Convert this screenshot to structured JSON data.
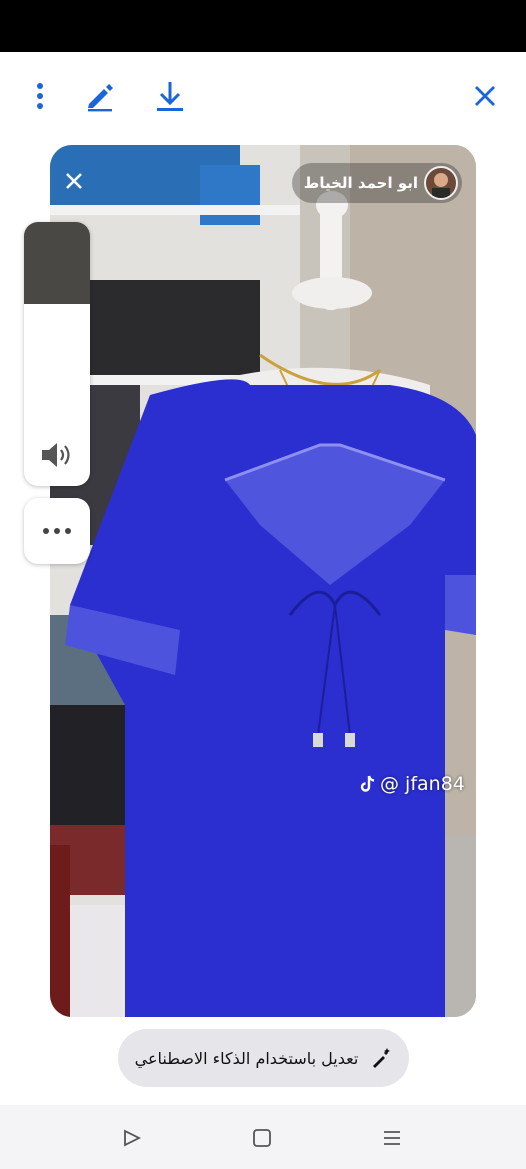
{
  "toolbar": {
    "icons": [
      "more-vertical-icon",
      "edit-pen-icon",
      "download-icon",
      "close-icon"
    ],
    "accent_color": "#1a66d9"
  },
  "photo": {
    "creator_name": "ابو احمد الخياط",
    "watermark_handle": "@ jfan84",
    "dress_color": "#2b2fd0"
  },
  "volume": {
    "level": 0.31
  },
  "ai_button": {
    "label": "تعديل باستخدام الذكاء الاصطناعي"
  },
  "navbar": {
    "icons": [
      "back-triangle-icon",
      "home-square-icon",
      "recents-lines-icon"
    ]
  }
}
